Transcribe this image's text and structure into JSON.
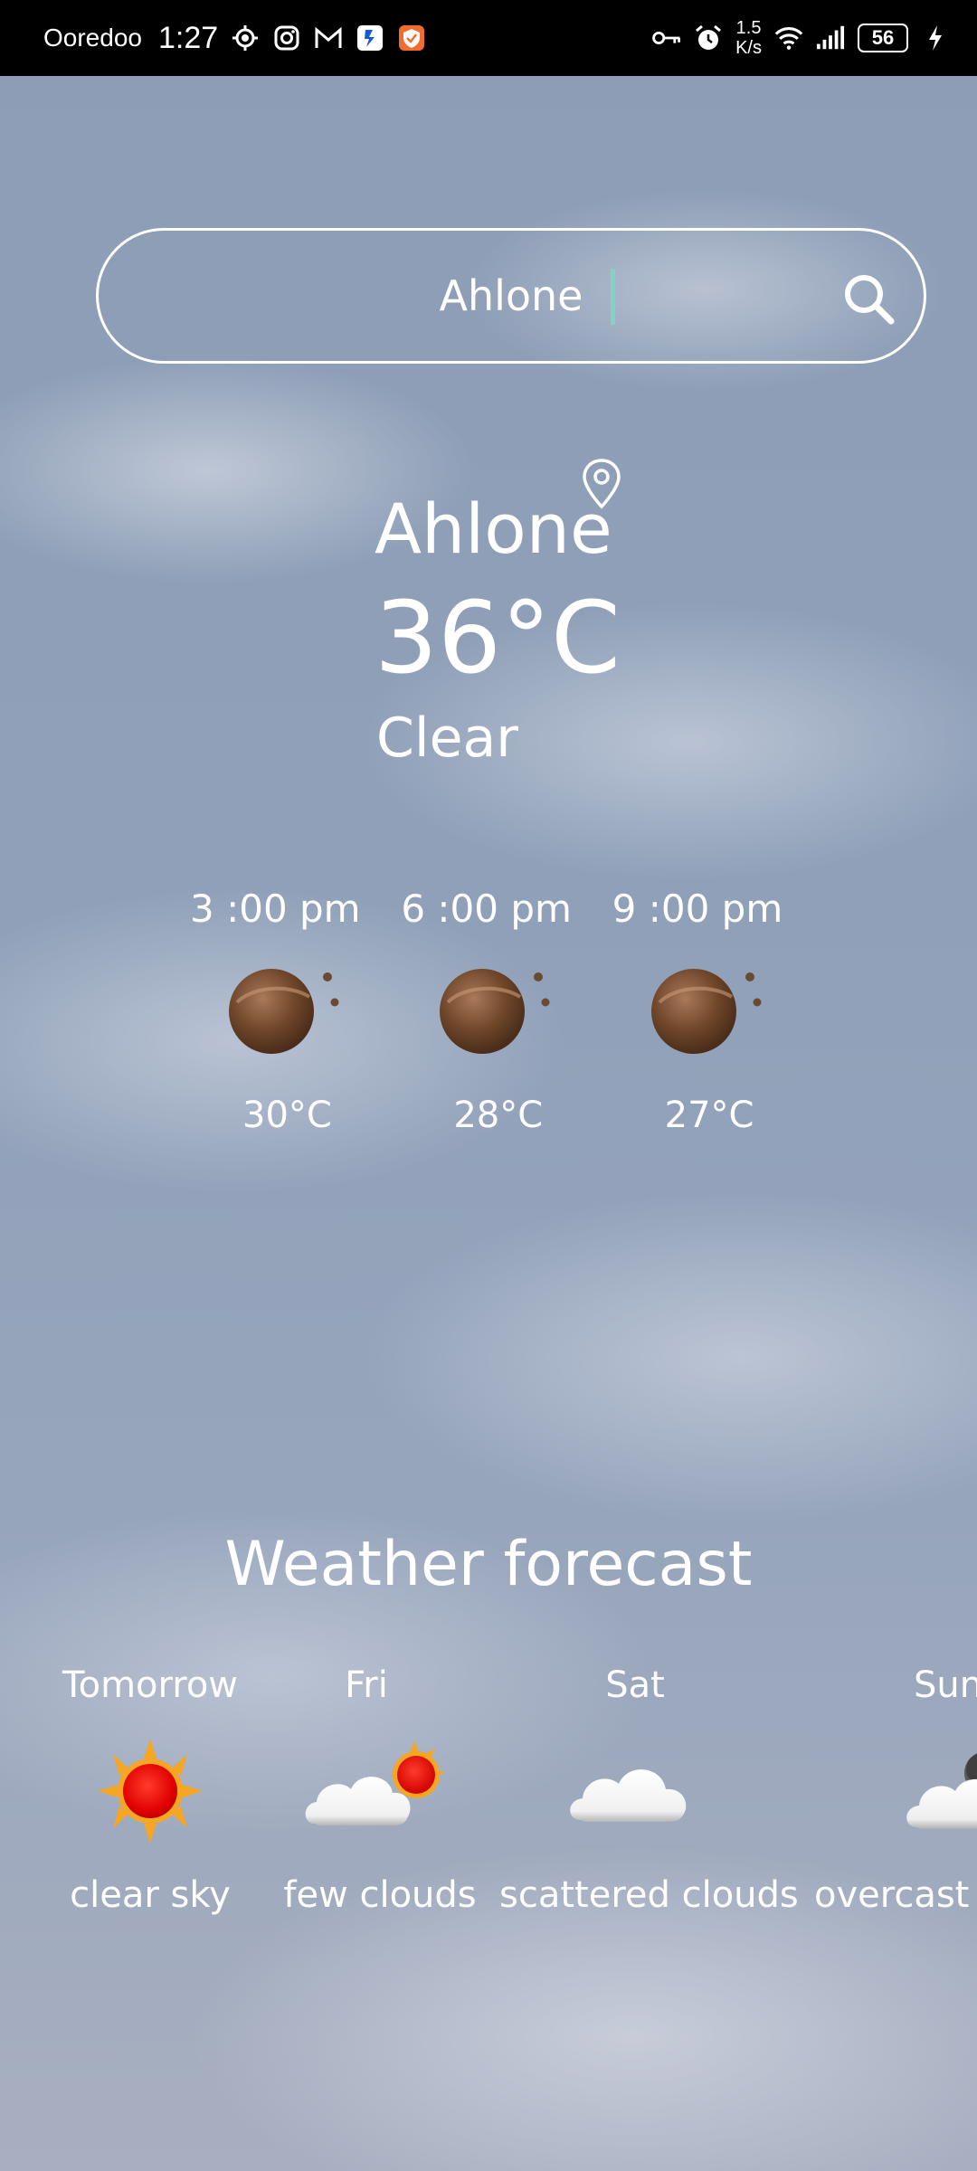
{
  "status_bar": {
    "carrier": "Ooredoo",
    "time": "1:27",
    "net_speed_value": "1.5",
    "net_speed_unit": "K/s",
    "battery": "56"
  },
  "search": {
    "value": "Ahlone"
  },
  "current": {
    "city": "Ahlone",
    "temperature": "36°C",
    "condition": "Clear"
  },
  "hourly": [
    {
      "time": "3 :00  pm",
      "temp": "30°C",
      "icon": "night-clear-icon"
    },
    {
      "time": "6 :00  pm",
      "temp": "28°C",
      "icon": "night-clear-icon"
    },
    {
      "time": "9 :00  pm",
      "temp": "27°C",
      "icon": "night-clear-icon"
    }
  ],
  "forecast": {
    "title": "Weather forecast",
    "days": [
      {
        "day": "Tomorrow",
        "description": "clear sky",
        "icon": "sun-icon"
      },
      {
        "day": "Fri",
        "description": "few clouds",
        "icon": "sun-cloud-icon"
      },
      {
        "day": "Sat",
        "description": "scattered clouds",
        "icon": "cloud-icon"
      },
      {
        "day": "Sun",
        "description": "overcast",
        "icon": "overcast-icon"
      }
    ]
  }
}
